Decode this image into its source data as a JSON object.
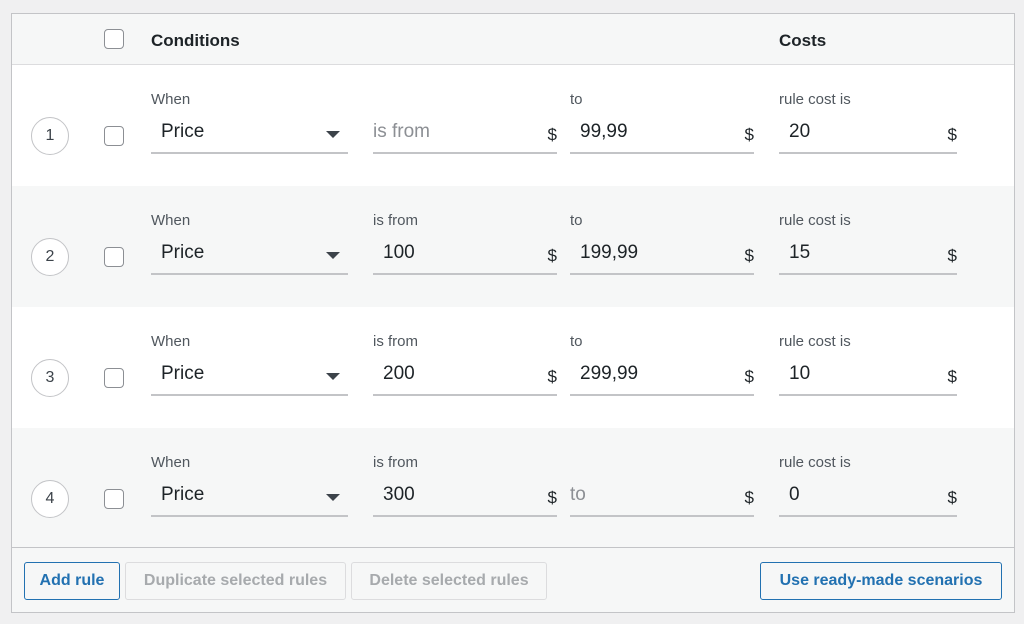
{
  "header": {
    "conditions_label": "Conditions",
    "costs_label": "Costs"
  },
  "rows": [
    {
      "number": "1",
      "when_label": "When",
      "condition": "Price",
      "from_label": "",
      "from_value": "",
      "from_placeholder": "is from",
      "from_currency": "$",
      "to_label": "to",
      "to_value": "99,99",
      "to_placeholder": "",
      "to_currency": "$",
      "cost_label": "rule cost is",
      "cost_value": "20",
      "cost_currency": "$"
    },
    {
      "number": "2",
      "when_label": "When",
      "condition": "Price",
      "from_label": "is from",
      "from_value": "100",
      "from_placeholder": "",
      "from_currency": "$",
      "to_label": "to",
      "to_value": "199,99",
      "to_placeholder": "",
      "to_currency": "$",
      "cost_label": "rule cost is",
      "cost_value": "15",
      "cost_currency": "$"
    },
    {
      "number": "3",
      "when_label": "When",
      "condition": "Price",
      "from_label": "is from",
      "from_value": "200",
      "from_placeholder": "",
      "from_currency": "$",
      "to_label": "to",
      "to_value": "299,99",
      "to_placeholder": "",
      "to_currency": "$",
      "cost_label": "rule cost is",
      "cost_value": "10",
      "cost_currency": "$"
    },
    {
      "number": "4",
      "when_label": "When",
      "condition": "Price",
      "from_label": "is from",
      "from_value": "300",
      "from_placeholder": "",
      "from_currency": "$",
      "to_label": "",
      "to_value": "",
      "to_placeholder": "to",
      "to_currency": "$",
      "cost_label": "rule cost is",
      "cost_value": "0",
      "cost_currency": "$"
    }
  ],
  "footer": {
    "add_rule": "Add rule",
    "duplicate": "Duplicate selected rules",
    "delete": "Delete selected rules",
    "scenarios": "Use ready-made scenarios"
  },
  "icons": {
    "dropdown": "chevron-down-icon",
    "checkbox": "checkbox-icon"
  },
  "colors": {
    "accent": "#2271b1",
    "disabled": "#a7aaad"
  }
}
